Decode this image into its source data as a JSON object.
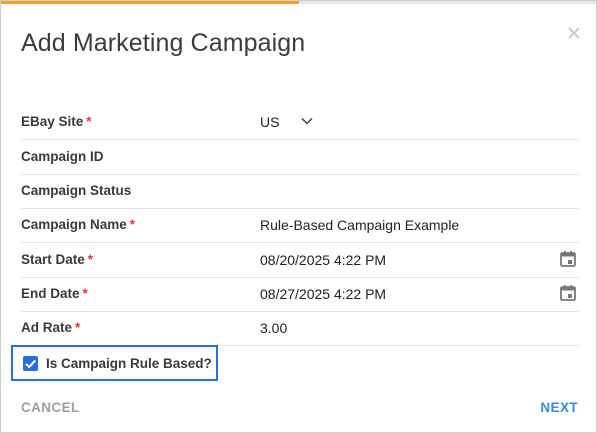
{
  "dialog": {
    "title": "Add Marketing Campaign",
    "progress_fraction": 0.5
  },
  "fields": {
    "ebay_site": {
      "label": "EBay Site",
      "required_mark": "*",
      "value": "US"
    },
    "campaign_id": {
      "label": "Campaign ID",
      "value": ""
    },
    "campaign_status": {
      "label": "Campaign Status",
      "value": ""
    },
    "campaign_name": {
      "label": "Campaign Name",
      "required_mark": "*",
      "value": "Rule-Based Campaign Example"
    },
    "start_date": {
      "label": "Start Date",
      "required_mark": "*",
      "value": "08/20/2025 4:22 PM"
    },
    "end_date": {
      "label": "End Date",
      "required_mark": "*",
      "value": "08/27/2025 4:22 PM"
    },
    "ad_rate": {
      "label": "Ad Rate",
      "required_mark": "*",
      "value": "3.00"
    }
  },
  "rule_based": {
    "label": "Is Campaign Rule Based?",
    "checked": true
  },
  "footer": {
    "cancel_label": "CANCEL",
    "next_label": "NEXT"
  },
  "icons": {
    "close": "close-icon",
    "dropdown": "chevron-down-icon",
    "calendar": "calendar-icon",
    "check": "check-icon"
  },
  "colors": {
    "progress": "#f0a030",
    "accent": "#2a6fdb",
    "required": "#e53935",
    "next": "#3a8be0"
  }
}
